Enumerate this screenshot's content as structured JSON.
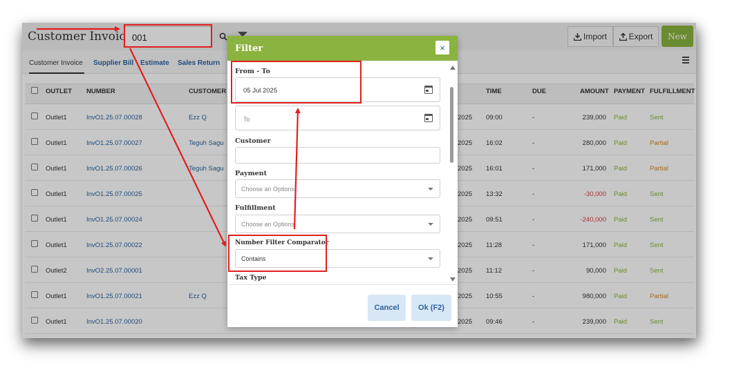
{
  "header": {
    "title": "Customer Invoice",
    "search_value": "001",
    "import_label": "Import",
    "export_label": "Export",
    "new_label": "New"
  },
  "tabs": [
    "Customer Invoice",
    "Supplier Bill",
    "Estimate",
    "Sales Return"
  ],
  "table": {
    "columns": [
      "OUTLET",
      "NUMBER",
      "CUSTOMER",
      "TIME",
      "DUE",
      "AMOUNT",
      "PAYMENT",
      "FULFILLMENT"
    ],
    "rows": [
      {
        "outlet": "Outlet1",
        "number": "InvO1.25.07.00028",
        "customer": "Ezz Q",
        "date": "2025",
        "time": "09:00",
        "due": "-",
        "amount": "239,000",
        "payment": "Paid",
        "fulfillment": "Sent"
      },
      {
        "outlet": "Outlet1",
        "number": "InvO1.25.07.00027",
        "customer": "Teguh Sagu",
        "date": "2025",
        "time": "16:02",
        "due": "-",
        "amount": "280,000",
        "payment": "Paid",
        "fulfillment": "Partial"
      },
      {
        "outlet": "Outlet1",
        "number": "InvO1.25.07.00026",
        "customer": "Teguh Sagu",
        "date": "2025",
        "time": "16:01",
        "due": "-",
        "amount": "171,000",
        "payment": "Paid",
        "fulfillment": "Partial"
      },
      {
        "outlet": "Outlet1",
        "number": "InvO1.25.07.00025",
        "customer": "",
        "date": "2025",
        "time": "13:32",
        "due": "-",
        "amount": "-30,000",
        "payment": "Paid",
        "fulfillment": "Sent"
      },
      {
        "outlet": "Outlet1",
        "number": "InvO1.25.07.00024",
        "customer": "",
        "date": "2025",
        "time": "09:51",
        "due": "-",
        "amount": "-240,000",
        "payment": "Paid",
        "fulfillment": "Sent"
      },
      {
        "outlet": "Outlet1",
        "number": "InvO1.25.07.00022",
        "customer": "",
        "date": "2025",
        "time": "11:28",
        "due": "-",
        "amount": "171,000",
        "payment": "Paid",
        "fulfillment": "Sent"
      },
      {
        "outlet": "Outlet2",
        "number": "InvO2.25.07.00001",
        "customer": "",
        "date": "2025",
        "time": "11:12",
        "due": "-",
        "amount": "90,000",
        "payment": "Paid",
        "fulfillment": "Sent"
      },
      {
        "outlet": "Outlet1",
        "number": "InvO1.25.07.00021",
        "customer": "Ezz Q",
        "date": "2025",
        "time": "10:55",
        "due": "-",
        "amount": "980,000",
        "payment": "Paid",
        "fulfillment": "Partial"
      },
      {
        "outlet": "Outlet1",
        "number": "InvO1.25.07.00020",
        "customer": "",
        "date": "2025",
        "time": "09:46",
        "due": "-",
        "amount": "239,000",
        "payment": "Paid",
        "fulfillment": "Sent"
      }
    ]
  },
  "filter": {
    "title": "Filter",
    "close_symbol": "×",
    "from_to_label": "From - To",
    "from_value": "05 Jul 2025",
    "to_placeholder": "To",
    "customer_label": "Customer",
    "customer_value": "",
    "payment_label": "Payment",
    "payment_placeholder": "Choose an Options",
    "fulfillment_label": "Fulfillment",
    "fulfillment_placeholder": "Choose an Options",
    "comparator_label": "Number Filter Comparator",
    "comparator_value": "Contains",
    "tax_type_label": "Tax Type",
    "cancel_label": "Cancel",
    "ok_label": "Ok (F2)"
  },
  "colors": {
    "accent_green": "#8ab33f",
    "link_blue": "#2a62a0",
    "partial_orange": "#d08a26",
    "negative_red": "#d94040",
    "annotation_red": "#e11d1d"
  }
}
